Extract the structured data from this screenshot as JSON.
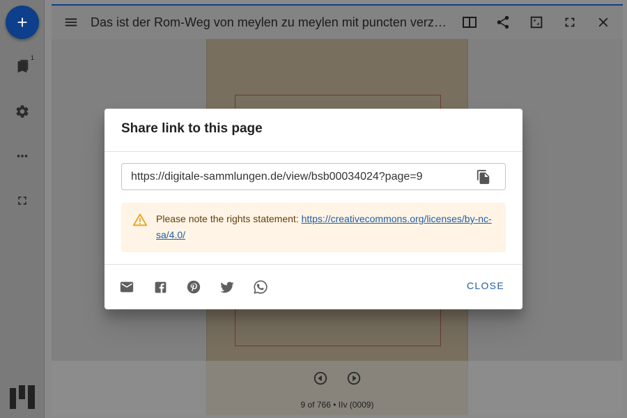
{
  "rail": {
    "add_icon": "plus-icon",
    "badge": "1",
    "items": [
      {
        "icon": "bookmark-icon"
      },
      {
        "icon": "gear-icon"
      },
      {
        "icon": "more-horizontal-icon"
      },
      {
        "icon": "fullscreen-icon"
      }
    ]
  },
  "window": {
    "title": "Das ist der Rom-Weg von meylen zu meylen mit puncten verzeychnet von einer stat zu der andern durch deutzsche lant",
    "buttons": [
      "book-view-icon",
      "share-icon",
      "maximize-icon",
      "fullscreen-icon",
      "close-icon"
    ]
  },
  "viewer": {
    "page_info": "9 of 766 • IIv (0009)"
  },
  "dialog": {
    "title": "Share link to this page",
    "url": "https://digitale-sammlungen.de/view/bsb00034024?page=9",
    "alert_prefix": "Please note the rights statement: ",
    "alert_link": "https://creativecommons.org/licenses/by-nc-sa/4.0/",
    "share_icons": [
      "email-icon",
      "facebook-icon",
      "pinterest-icon",
      "twitter-icon",
      "whatsapp-icon"
    ],
    "close_label": "CLOSE"
  },
  "colors": {
    "accent": "#1e5ea8",
    "add_button": "#0d3f8a",
    "alert_bg": "#fff4e5",
    "alert_icon": "#f0a020"
  }
}
